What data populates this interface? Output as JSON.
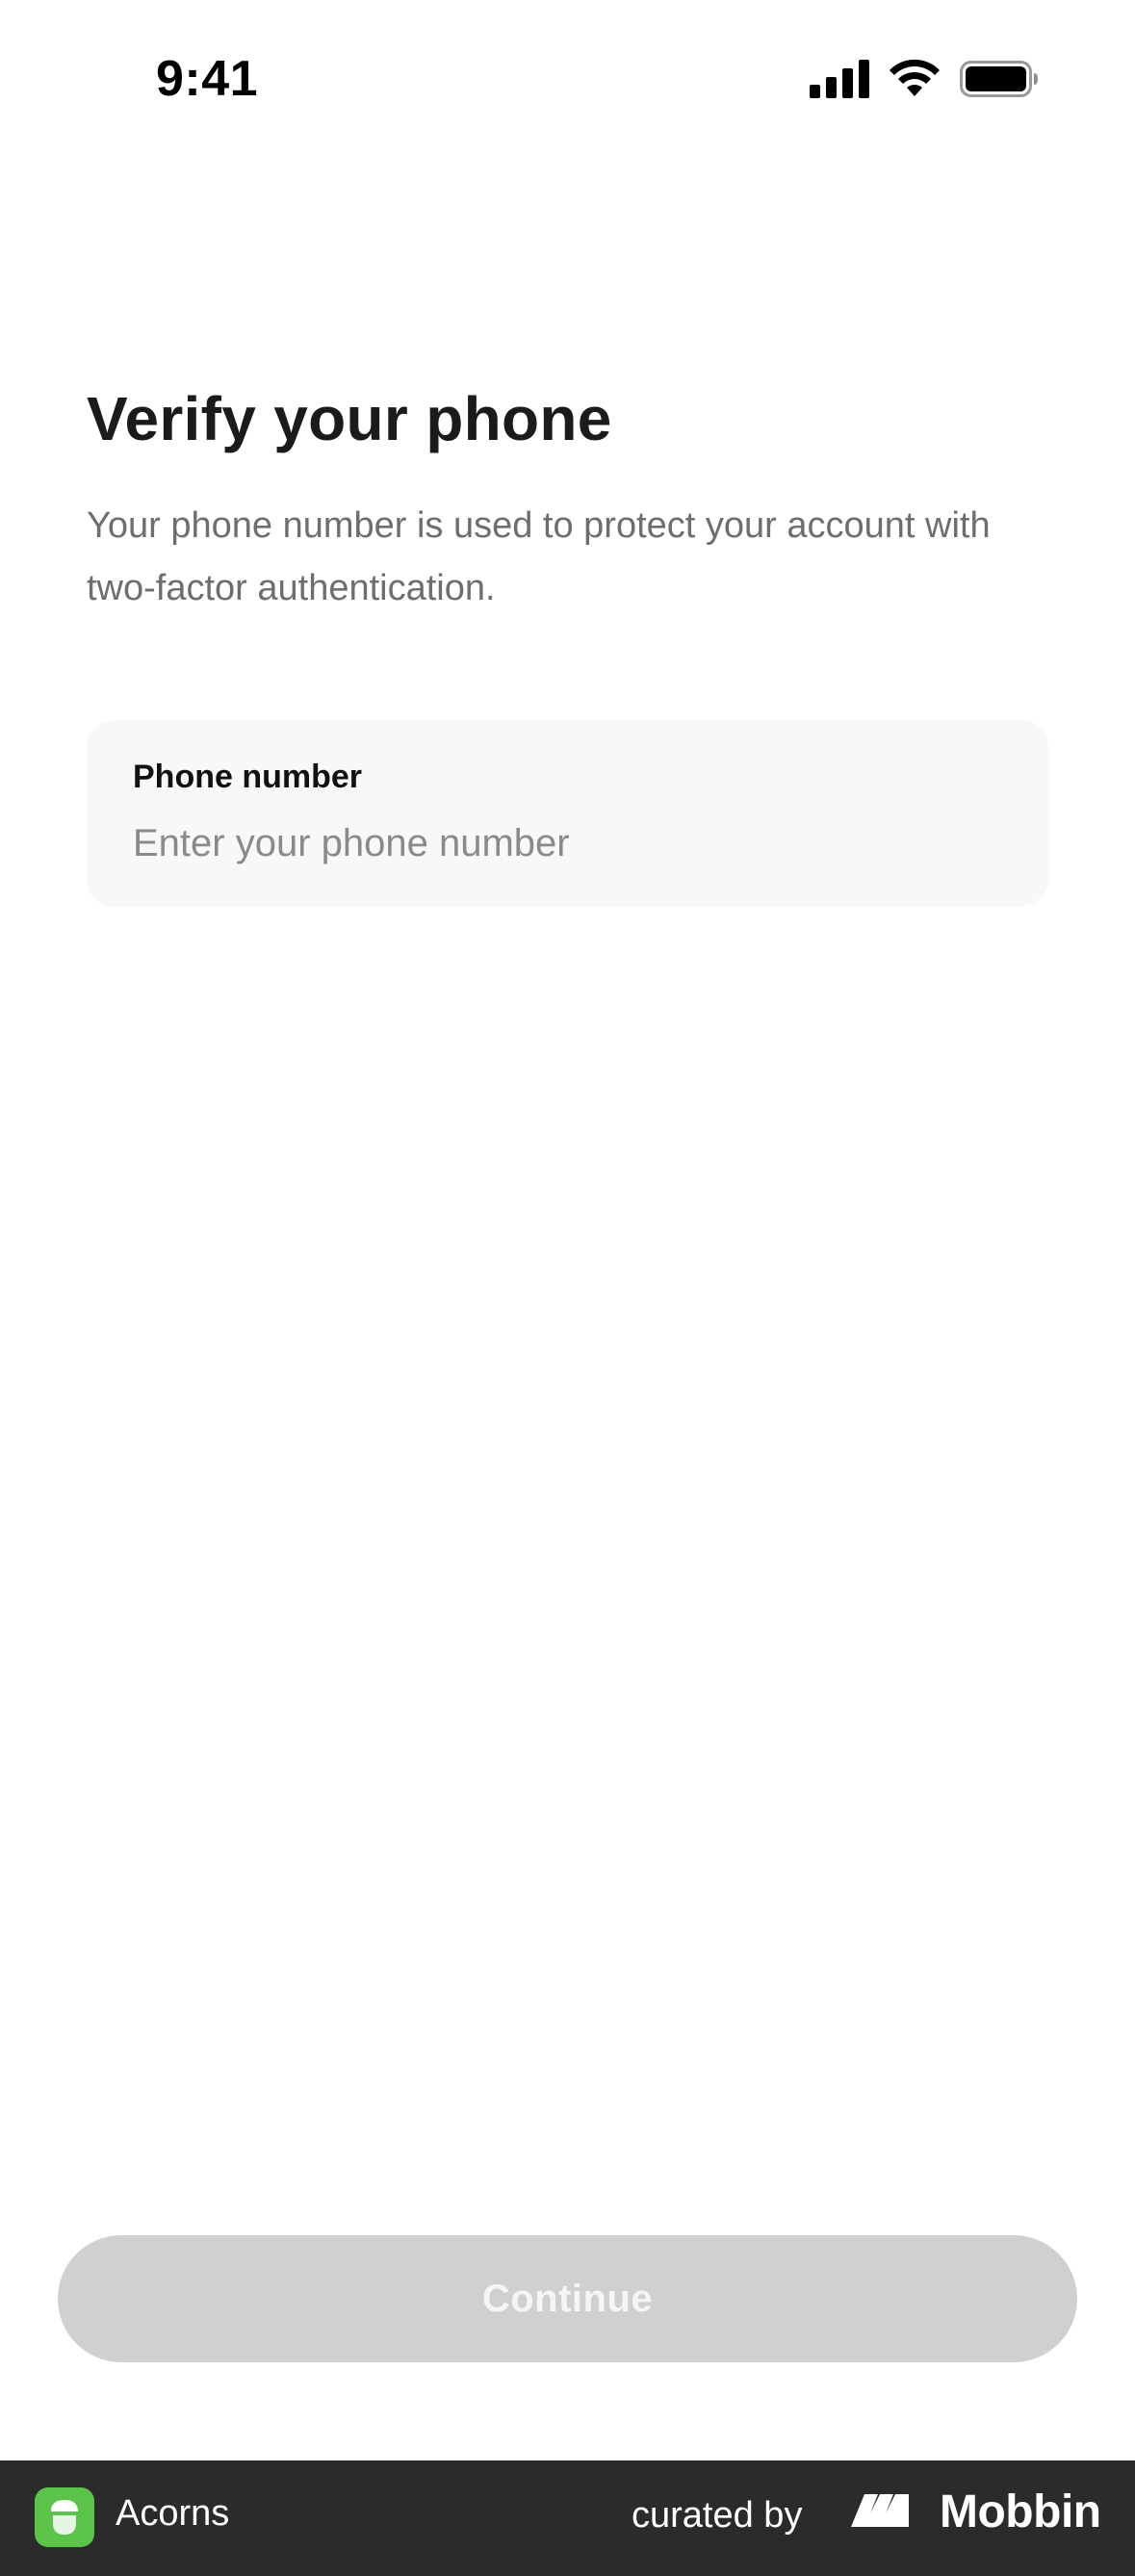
{
  "status_bar": {
    "time": "9:41",
    "icons": [
      "cellular-signal-icon",
      "wifi-icon",
      "battery-icon"
    ]
  },
  "header": {
    "title": "Verify your phone",
    "subtitle": "Your phone number is used to protect your account with two-factor authentication."
  },
  "phone_field": {
    "label": "Phone number",
    "placeholder": "Enter your phone number",
    "value": ""
  },
  "actions": {
    "continue_label": "Continue"
  },
  "footer": {
    "app_name": "Acorns",
    "curated_by": "curated by",
    "brand": "Mobbin",
    "icons": [
      "acorns-app-icon",
      "mobbin-logo-icon"
    ]
  },
  "colors": {
    "background": "#ffffff",
    "field_background": "#f8f8f8",
    "button_disabled": "#cfd0cf",
    "footer_background": "#2b2b2b",
    "app_icon_green": "#5cc34a"
  }
}
